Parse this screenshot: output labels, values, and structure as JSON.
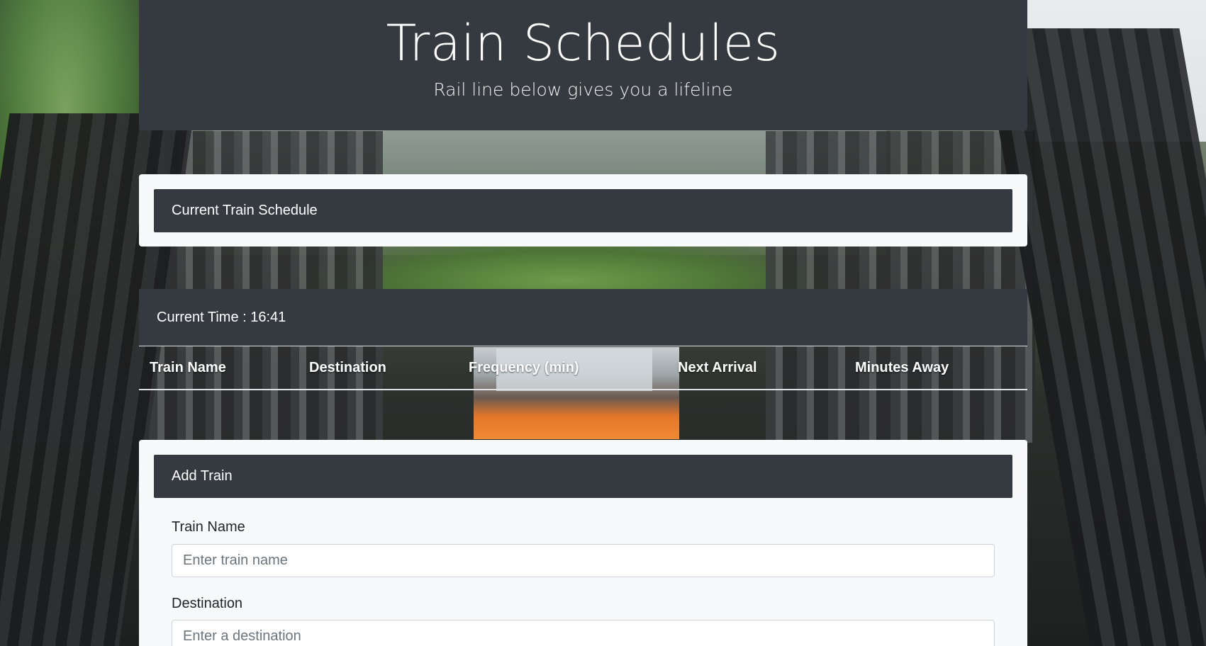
{
  "header": {
    "title": "Train Schedules",
    "subtitle": "Rail line below gives you a lifeline"
  },
  "schedule_card": {
    "title": "Current Train Schedule"
  },
  "current_time": {
    "label": "Current Time : 16:41"
  },
  "table": {
    "columns": [
      "Train Name",
      "Destination",
      "Frequency (min)",
      "Next Arrival",
      "Minutes Away"
    ]
  },
  "add_train": {
    "title": "Add Train",
    "fields": [
      {
        "label": "Train Name",
        "placeholder": "Enter train name"
      },
      {
        "label": "Destination",
        "placeholder": "Enter a destination"
      }
    ]
  },
  "colors": {
    "panel_dark": "#343a40",
    "card_light": "#f8f9fa",
    "input_border": "#ced4da"
  }
}
